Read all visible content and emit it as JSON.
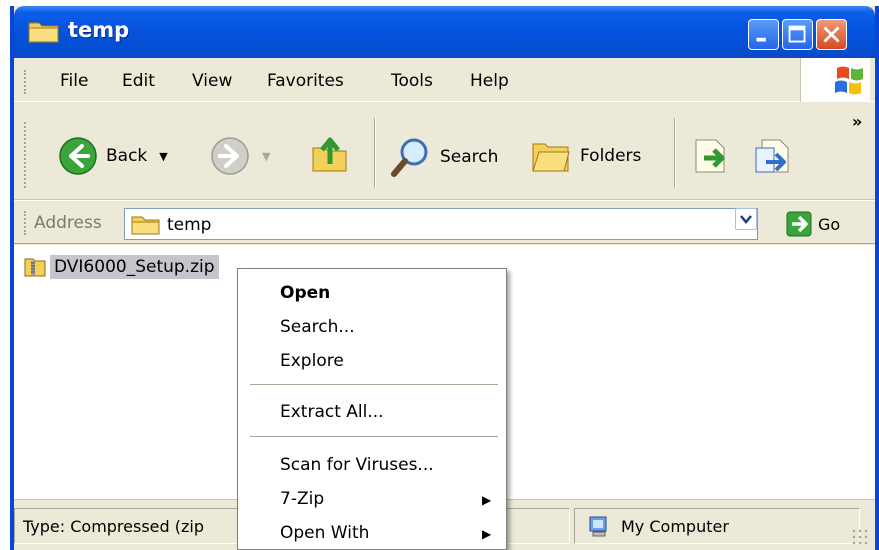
{
  "window": {
    "title": "temp",
    "controls": {
      "minimize": "minimize",
      "maximize": "maximize",
      "close": "close"
    }
  },
  "menubar": {
    "items": [
      "File",
      "Edit",
      "View",
      "Favorites",
      "Tools",
      "Help"
    ]
  },
  "toolbar": {
    "back_label": "Back",
    "search_label": "Search",
    "folders_label": "Folders",
    "more": "»"
  },
  "address": {
    "label": "Address",
    "value": "temp",
    "go_label": "Go"
  },
  "content": {
    "files": [
      {
        "name": "DVI6000_Setup.zip",
        "icon": "zip-folder-icon",
        "selected": true
      }
    ]
  },
  "statusbar": {
    "type_text": "Type: Compressed (zip",
    "location_text": "My Computer"
  },
  "context_menu": {
    "items": [
      {
        "label": "Open",
        "bold": true
      },
      {
        "label": "Search..."
      },
      {
        "label": "Explore"
      },
      {
        "label": "Extract All..."
      },
      {
        "label": "Scan for Viruses..."
      },
      {
        "label": "7-Zip",
        "submenu": true
      },
      {
        "label": "Open With",
        "submenu": true
      }
    ]
  },
  "colors": {
    "title_bar": "#0553de",
    "chrome": "#ece9d8",
    "selection": "#c4c6cc",
    "close_button": "#d44a25"
  }
}
